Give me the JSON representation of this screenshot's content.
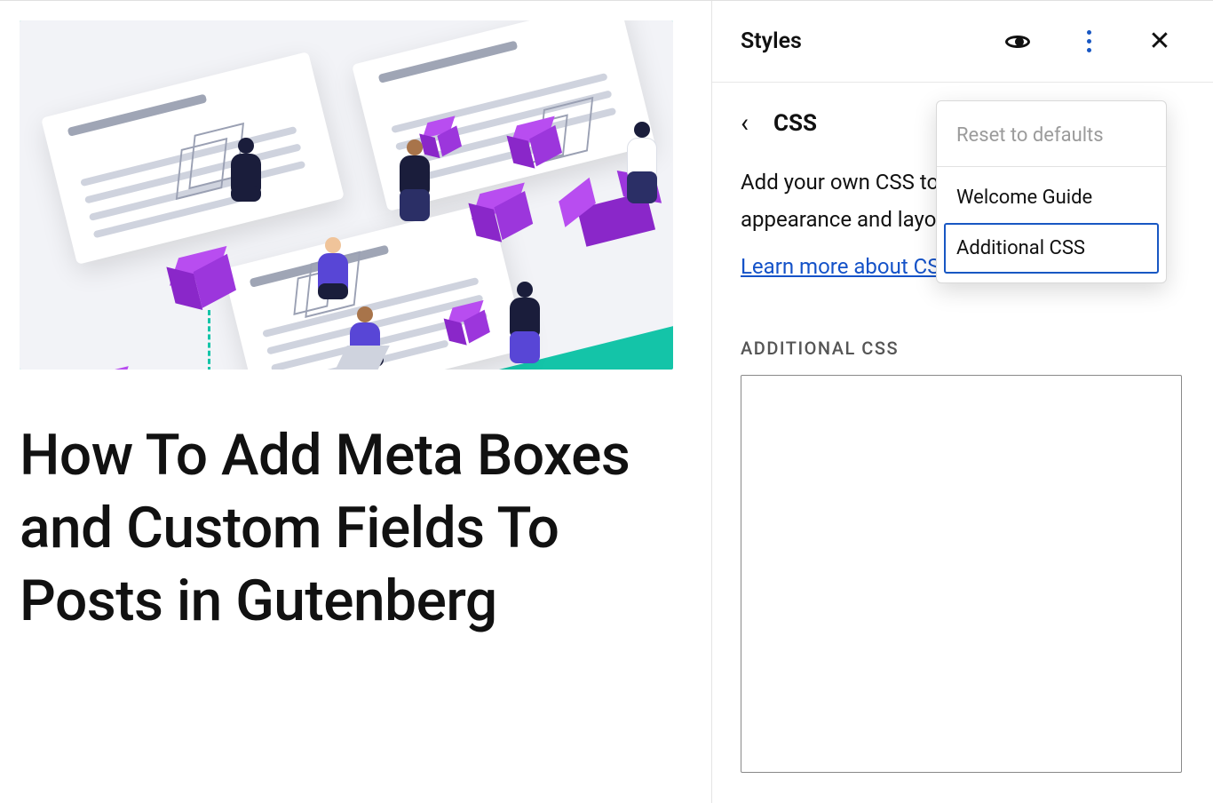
{
  "editor": {
    "post_title": "How To Add Meta Boxes and Custom Fields To Posts in Gutenberg"
  },
  "sidebar": {
    "title": "Styles",
    "crumb_label": "CSS",
    "desc": "Add your own CSS to customize the appearance and layout of your site.",
    "link": "Learn more about CSS",
    "section_label": "ADDITIONAL CSS",
    "css_value": ""
  },
  "dropdown": {
    "reset": "Reset to defaults",
    "welcome": "Welcome Guide",
    "additional": "Additional CSS"
  }
}
